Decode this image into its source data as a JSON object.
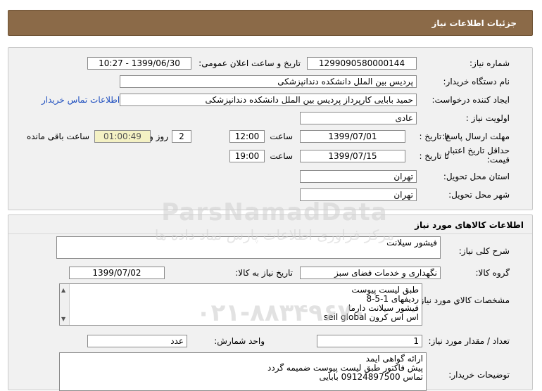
{
  "header": {
    "title": "جزئیات اطلاعات نیاز"
  },
  "need_info": {
    "need_number_label": "شماره نیاز:",
    "need_number": "1299090580000144",
    "announce_label": "تاریخ و ساعت اعلان عمومی:",
    "announce_value": "1399/06/30 - 10:27",
    "buyer_org_label": "نام دستگاه خریدار:",
    "buyer_org": "پردیس بین الملل دانشکده دندانپزشکی",
    "requester_label": "ایجاد کننده درخواست:",
    "requester": "حمید بابایی کارپرداز پردیس بین الملل دانشکده دندانپزشکی",
    "contact_link": "اطلاعات تماس خریدار",
    "priority_label": "اولویت نیاز :",
    "priority": "عادی",
    "reply_deadline_label": "مهلت ارسال پاسخ:",
    "to_date_label": "تا تاریخ :",
    "reply_date": "1399/07/01",
    "time_label": "ساعت",
    "reply_time": "12:00",
    "days_value": "2",
    "days_label": "روز و",
    "remaining_time": "01:00:49",
    "remaining_label": "ساعت باقی مانده",
    "price_validity_label": "حداقل تاریخ اعتبار قیمت:",
    "price_date": "1399/07/15",
    "price_time": "19:00",
    "province_label": "استان محل تحویل:",
    "province": "تهران",
    "city_label": "شهر محل تحویل:",
    "city": "تهران"
  },
  "goods": {
    "section_title": "اطلاعات کالاهای مورد نیاز",
    "summary_label": "شرح کلی نیاز:",
    "summary": "فیشور سیلانت",
    "group_label": "گروه کالا:",
    "group": "نگهداری و خدمات فضای سبز",
    "need_date_label": "تاریخ نیاز به کالا:",
    "need_date": "1399/07/02",
    "details_label": "مشخصات کالاي مورد نياز:",
    "details_lines": [
      "طبق لیست پیوست",
      "ردیفهای 1-5-8",
      "فیشور سیلانت دارما",
      "اس اس کرون seil global"
    ],
    "qty_label": "تعداد / مقدار مورد نیاز:",
    "qty": "1",
    "unit_label": "واحد شمارش:",
    "unit": "عدد",
    "buyer_notes_label": "توضیحات خریدار:",
    "buyer_notes_lines": [
      "ارائه گواهی ایمد",
      "پیش فاکتور طبق لیست پیوست ضمیمه گردد",
      "تماس 09124897500   بابایی"
    ]
  },
  "watermark": {
    "brand": "ParsNamadData",
    "tagline": "مرکز فراوری اطلاعات پارس نماد داده ها",
    "phone": "۰۲۱-۸۸۳۴۹۶۷۰"
  }
}
